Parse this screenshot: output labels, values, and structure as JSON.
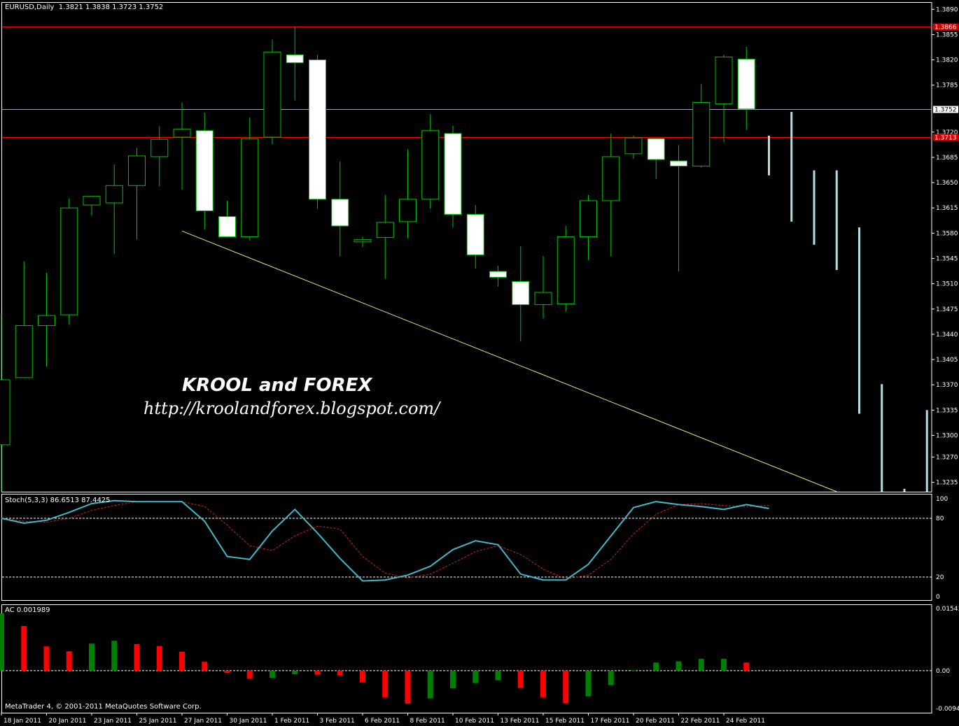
{
  "title": "EURUSD,Daily",
  "ohlc_text": "1.3821 1.3838 1.3723 1.3752",
  "stoch_label": "Stoch(5,3,3) 86.6513 87.4425",
  "ac_label": "AC 0.001989",
  "copyright": "MetaTrader 4, © 2001-2011 MetaQuotes Software Corp.",
  "watermark": {
    "name": "KROOL and FOREX",
    "url": "http://kroolandforex.blogspot.com/"
  },
  "colors": {
    "background": "#000000",
    "candle_bull": "#000000",
    "candle_bear": "#ffffff",
    "candle_outline": "#00c000",
    "level_line": "#ff0000",
    "bid_line": "#a0a0b8",
    "trend_line": "#e6e680",
    "stoch_main": "#40b8c8",
    "stoch_signal": "#d02020",
    "ac_up": "#008000",
    "ac_down": "#ff0000",
    "forecast_bars": "#b0e0e0"
  },
  "chart_data": [
    {
      "type": "candlestick",
      "name": "EURUSD,Daily",
      "price_ticks": [
        "1.3890",
        "1.3855",
        "1.3820",
        "1.3785",
        "1.3720",
        "1.3685",
        "1.3650",
        "1.3615",
        "1.3580",
        "1.3545",
        "1.3510",
        "1.3475",
        "1.3440",
        "1.3405",
        "1.3370",
        "1.3335",
        "1.3300",
        "1.3270",
        "1.3235"
      ],
      "ylim": [
        1.3222,
        1.39
      ],
      "levels": [
        {
          "price": 1.3866,
          "label": "1.3866",
          "kind": "resistance"
        },
        {
          "price": 1.3713,
          "label": "1.3713",
          "kind": "support"
        },
        {
          "price": 1.3752,
          "label": "1.3752",
          "kind": "bid"
        }
      ],
      "date_labels": [
        "18 Jan 2011",
        "20 Jan 2011",
        "23 Jan 2011",
        "25 Jan 2011",
        "27 Jan 2011",
        "30 Jan 2011",
        "1 Feb 2011",
        "3 Feb 2011",
        "6 Feb 2011",
        "8 Feb 2011",
        "10 Feb 2011",
        "13 Feb 2011",
        "15 Feb 2011",
        "17 Feb 2011",
        "20 Feb 2011",
        "22 Feb 2011",
        "24 Feb 2011"
      ],
      "candles": [
        {
          "o": 1.3287,
          "h": 1.3468,
          "l": 1.3222,
          "c": 1.3377
        },
        {
          "o": 1.338,
          "h": 1.3541,
          "l": 1.338,
          "c": 1.3452
        },
        {
          "o": 1.3452,
          "h": 1.3525,
          "l": 1.3395,
          "c": 1.3466
        },
        {
          "o": 1.3467,
          "h": 1.3628,
          "l": 1.3453,
          "c": 1.3615
        },
        {
          "o": 1.3619,
          "h": 1.3631,
          "l": 1.3604,
          "c": 1.3631
        },
        {
          "o": 1.3622,
          "h": 1.3675,
          "l": 1.3551,
          "c": 1.3646
        },
        {
          "o": 1.3646,
          "h": 1.3698,
          "l": 1.3571,
          "c": 1.3687
        },
        {
          "o": 1.3686,
          "h": 1.3728,
          "l": 1.3645,
          "c": 1.371
        },
        {
          "o": 1.3713,
          "h": 1.3761,
          "l": 1.364,
          "c": 1.3724
        },
        {
          "o": 1.3722,
          "h": 1.3747,
          "l": 1.3585,
          "c": 1.3611
        },
        {
          "o": 1.3603,
          "h": 1.3625,
          "l": 1.3574,
          "c": 1.3575
        },
        {
          "o": 1.3575,
          "h": 1.374,
          "l": 1.357,
          "c": 1.3711
        },
        {
          "o": 1.3713,
          "h": 1.3848,
          "l": 1.3703,
          "c": 1.3831
        },
        {
          "o": 1.3827,
          "h": 1.3866,
          "l": 1.3764,
          "c": 1.3816
        },
        {
          "o": 1.382,
          "h": 1.3827,
          "l": 1.3614,
          "c": 1.3627
        },
        {
          "o": 1.3627,
          "h": 1.3679,
          "l": 1.3548,
          "c": 1.359
        },
        {
          "o": 1.3568,
          "h": 1.3575,
          "l": 1.3561,
          "c": 1.3571
        },
        {
          "o": 1.3574,
          "h": 1.3633,
          "l": 1.3517,
          "c": 1.3595
        },
        {
          "o": 1.3596,
          "h": 1.3696,
          "l": 1.3573,
          "c": 1.3627
        },
        {
          "o": 1.3627,
          "h": 1.3745,
          "l": 1.3614,
          "c": 1.3722
        },
        {
          "o": 1.3718,
          "h": 1.3729,
          "l": 1.3588,
          "c": 1.3606
        },
        {
          "o": 1.3606,
          "h": 1.3619,
          "l": 1.3531,
          "c": 1.355
        },
        {
          "o": 1.3527,
          "h": 1.3535,
          "l": 1.3506,
          "c": 1.3519
        },
        {
          "o": 1.3513,
          "h": 1.3562,
          "l": 1.343,
          "c": 1.3481
        },
        {
          "o": 1.3481,
          "h": 1.3548,
          "l": 1.3462,
          "c": 1.3498
        },
        {
          "o": 1.3482,
          "h": 1.359,
          "l": 1.3471,
          "c": 1.3575
        },
        {
          "o": 1.3575,
          "h": 1.3633,
          "l": 1.3543,
          "c": 1.3625
        },
        {
          "o": 1.3625,
          "h": 1.3718,
          "l": 1.3548,
          "c": 1.3686
        },
        {
          "o": 1.369,
          "h": 1.3715,
          "l": 1.3683,
          "c": 1.3712
        },
        {
          "o": 1.3711,
          "h": 1.3711,
          "l": 1.3655,
          "c": 1.3682
        },
        {
          "o": 1.368,
          "h": 1.3702,
          "l": 1.3527,
          "c": 1.3673
        },
        {
          "o": 1.3673,
          "h": 1.3787,
          "l": 1.3671,
          "c": 1.3761
        },
        {
          "o": 1.3759,
          "h": 1.3827,
          "l": 1.3706,
          "c": 1.3824
        },
        {
          "o": 1.3821,
          "h": 1.3838,
          "l": 1.3723,
          "c": 1.3752
        }
      ],
      "forecast_bars": [
        {
          "top": 1.3715,
          "bottom": 1.366
        },
        {
          "top": 1.3748,
          "bottom": 1.3596
        },
        {
          "top": 1.3667,
          "bottom": 1.3564
        },
        {
          "top": 1.3667,
          "bottom": 1.3529
        },
        {
          "top": 1.3588,
          "bottom": 1.333
        },
        {
          "top": 1.3371,
          "bottom": 1.3222
        },
        {
          "top": 1.3226,
          "bottom": 1.3222
        },
        {
          "top": 1.3335,
          "bottom": 1.3222
        }
      ],
      "trend_line": {
        "from": {
          "bar": 8,
          "price": 1.3583
        },
        "to": {
          "bar": 37,
          "price": 1.3222
        }
      }
    },
    {
      "type": "line",
      "name": "Stoch(5,3,3)",
      "ylim": [
        0,
        100
      ],
      "ticks": [
        "100",
        "80",
        "20",
        "0"
      ],
      "levels": [
        80,
        20
      ],
      "series": [
        {
          "name": "main",
          "values": [
            80,
            75,
            78,
            86,
            95,
            98,
            97,
            97,
            97,
            77,
            41,
            38,
            67,
            89,
            65,
            39,
            16,
            17,
            22,
            31,
            48,
            57,
            53,
            23,
            17,
            17,
            33,
            62,
            91,
            97,
            94,
            92,
            89,
            94,
            90
          ]
        },
        {
          "name": "signal",
          "values": [
            80,
            77,
            76,
            80,
            88,
            93,
            97,
            97,
            97,
            92,
            73,
            52,
            47,
            62,
            72,
            69,
            41,
            24,
            19,
            23,
            34,
            46,
            52,
            43,
            28,
            18,
            22,
            38,
            64,
            84,
            94,
            95,
            93,
            92,
            93
          ]
        }
      ]
    },
    {
      "type": "bar",
      "name": "AC",
      "ylim": [
        -0.00941,
        0.01543
      ],
      "ticks": [
        "0.01543",
        "0.00",
        "-0.00941"
      ],
      "values": [
        0.0142,
        0.0111,
        0.006,
        0.0048,
        0.0067,
        0.0074,
        0.0066,
        0.0061,
        0.0047,
        0.0022,
        -0.0006,
        -0.002,
        -0.0018,
        -0.0009,
        -0.001,
        -0.0012,
        -0.0029,
        -0.0066,
        -0.0082,
        -0.0069,
        -0.0044,
        -0.0031,
        -0.0024,
        -0.0043,
        -0.0066,
        -0.0081,
        -0.0064,
        -0.0036,
        0.0001,
        0.002,
        0.0023,
        0.0029,
        0.0029,
        0.002
      ],
      "colors": [
        "up",
        "down",
        "down",
        "down",
        "up",
        "up",
        "down",
        "down",
        "down",
        "down",
        "down",
        "down",
        "up",
        "up",
        "down",
        "down",
        "down",
        "down",
        "down",
        "up",
        "up",
        "up",
        "up",
        "down",
        "down",
        "down",
        "up",
        "up",
        "up",
        "up",
        "up",
        "up",
        "up",
        "down"
      ]
    }
  ]
}
